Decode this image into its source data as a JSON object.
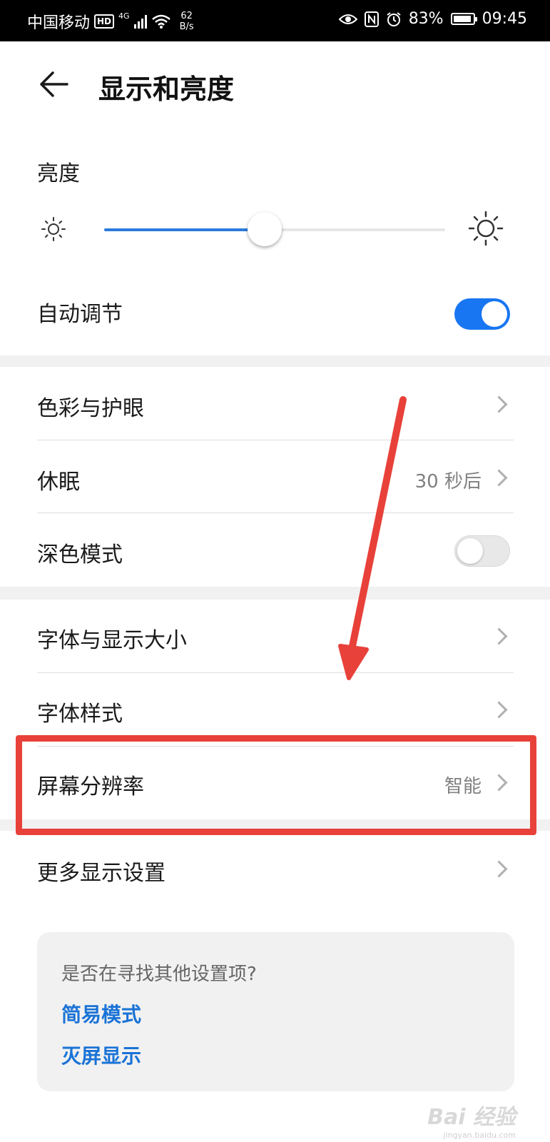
{
  "status_bar": {
    "carrier": "中国移动",
    "hd_badge": "HD",
    "network_type": "4G",
    "net_speed_value": "62",
    "net_speed_unit": "B/s",
    "battery_level": "83%",
    "time": "09:45"
  },
  "header": {
    "title": "显示和亮度"
  },
  "brightness": {
    "label": "亮度",
    "level": 0.47
  },
  "auto_adjust": {
    "label": "自动调节",
    "enabled": true
  },
  "settings": {
    "color_eye_care": {
      "label": "色彩与护眼"
    },
    "sleep": {
      "label": "休眠",
      "value": "30 秒后"
    },
    "dark_mode": {
      "label": "深色模式",
      "enabled": false
    },
    "font_display_size": {
      "label": "字体与显示大小"
    },
    "font_style": {
      "label": "字体样式"
    },
    "screen_resolution": {
      "label": "屏幕分辨率",
      "value": "智能"
    },
    "more_display": {
      "label": "更多显示设置"
    }
  },
  "suggestions": {
    "question": "是否在寻找其他设置项?",
    "links": [
      "简易模式",
      "灭屏显示"
    ]
  },
  "watermark": {
    "brand": "Bai 经验",
    "url": "jingyan.baidu.com"
  },
  "colors": {
    "accent": "#1876f2",
    "annotation_red": "#e8413a",
    "link": "#1a73d6"
  }
}
